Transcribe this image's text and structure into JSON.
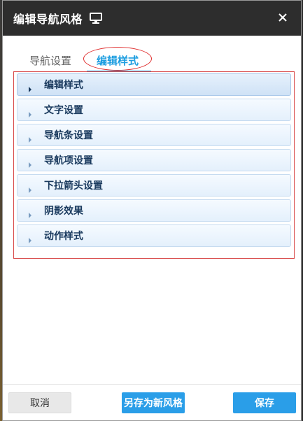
{
  "dialog": {
    "title": "编辑导航风格",
    "title_icon": "monitor-icon",
    "close_icon": "close-icon"
  },
  "tabs": [
    {
      "label": "导航设置",
      "active": false
    },
    {
      "label": "编辑样式",
      "active": true
    }
  ],
  "accordion": {
    "items": [
      {
        "label": "编辑样式",
        "active": true
      },
      {
        "label": "文字设置",
        "active": false
      },
      {
        "label": "导航条设置",
        "active": false
      },
      {
        "label": "导航项设置",
        "active": false
      },
      {
        "label": "下拉箭头设置",
        "active": false
      },
      {
        "label": "阴影效果",
        "active": false
      },
      {
        "label": "动作样式",
        "active": false
      }
    ]
  },
  "footer": {
    "cancel_label": "取消",
    "save_as_label": "另存为新风格",
    "save_label": "保存"
  },
  "colors": {
    "titlebar": "#2d2d2d",
    "accent": "#1e9ee0",
    "highlight_border": "#e03030"
  }
}
